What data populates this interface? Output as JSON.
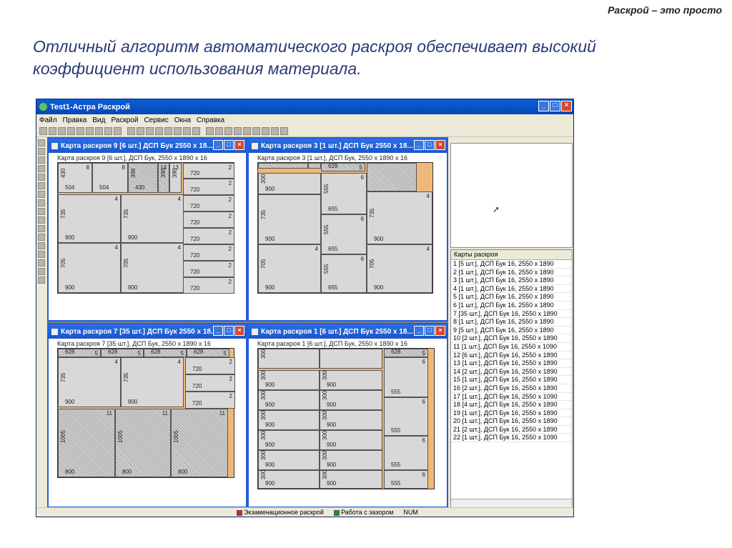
{
  "slide": {
    "header": "Раскрой – это просто",
    "title": "Отличный алгоритм автоматического раскроя обеспечивает высокий коэффициент использования материала."
  },
  "app": {
    "title": "Test1-Астра Раскрой",
    "menu": [
      "Файл",
      "Правка",
      "Вид",
      "Раскрой",
      "Сервис",
      "Окна",
      "Справка"
    ],
    "status": [
      "Экзаменационное раскрой",
      "Работа с зазором",
      "NUM"
    ]
  },
  "windows": [
    {
      "title": "Карта раскроя 9 [6 шт.] ДСП Бук 2550 x 18...",
      "caption": "Карта раскроя 9 [6 шт.], ДСП Бук, 2550 x 1890 x 16",
      "pieces": [
        {
          "w": "504",
          "h": "430",
          "c": "8",
          "hatch": false
        },
        {
          "w": "504",
          "h": "",
          "c": "8",
          "hatch": false
        },
        {
          "w": "430",
          "h": "398",
          "c": "",
          "hatch": true
        },
        {
          "w": "",
          "h": "390",
          "c": "14",
          "hatch": true
        },
        {
          "w": "",
          "h": "390",
          "c": "13",
          "hatch": false
        },
        {
          "w": "720",
          "h": "",
          "c": "2",
          "hatch": false
        },
        {
          "w": "720",
          "h": "",
          "c": "2",
          "hatch": false
        },
        {
          "w": "720",
          "h": "",
          "c": "2",
          "hatch": false
        },
        {
          "w": "720",
          "h": "",
          "c": "2",
          "hatch": false
        },
        {
          "w": "720",
          "h": "",
          "c": "2",
          "hatch": false
        },
        {
          "w": "720",
          "h": "",
          "c": "2",
          "hatch": false
        },
        {
          "w": "720",
          "h": "",
          "c": "2",
          "hatch": false
        },
        {
          "w": "720",
          "h": "",
          "c": "2",
          "hatch": false
        },
        {
          "w": "900",
          "h": "735",
          "c": "4",
          "hatch": false
        },
        {
          "w": "900",
          "h": "735",
          "c": "4",
          "hatch": false
        },
        {
          "w": "900",
          "h": "705",
          "c": "4",
          "hatch": false
        },
        {
          "w": "900",
          "h": "705",
          "c": "4",
          "hatch": false
        }
      ]
    },
    {
      "title": "Карта раскроя 3 [1 шт.] ДСП Бук 2550 x 18...",
      "caption": "Карта раскроя 3 [1 шт.], ДСП Бук, 2550 x 1890 x 16",
      "pieces": [
        {
          "w": "",
          "h": "",
          "c": "",
          "hatch": true
        },
        {
          "w": "",
          "h": "",
          "c": "",
          "hatch": true
        },
        {
          "w": "628",
          "h": "",
          "c": "5",
          "hatch": true
        },
        {
          "w": "",
          "h": "",
          "c": "",
          "hatch": true
        },
        {
          "w": "900",
          "h": "300",
          "c": "",
          "hatch": false
        },
        {
          "w": "655",
          "h": "555",
          "c": "6",
          "hatch": false
        },
        {
          "w": "900",
          "h": "735",
          "c": "",
          "hatch": false
        },
        {
          "w": "655",
          "h": "555",
          "c": "6",
          "hatch": false
        },
        {
          "w": "900",
          "h": "735",
          "c": "4",
          "hatch": false
        },
        {
          "w": "900",
          "h": "705",
          "c": "4",
          "hatch": false
        },
        {
          "w": "655",
          "h": "555",
          "c": "6",
          "hatch": false
        },
        {
          "w": "900",
          "h": "705",
          "c": "4",
          "hatch": false
        }
      ]
    },
    {
      "title": "Карта раскроя 7 [35 шт.] ДСП Бук 2550 x 18...",
      "caption": "Карта раскроя 7 [35 шт.], ДСП Бук, 2550 x 1890 x 16",
      "pieces": [
        {
          "w": "628",
          "h": "",
          "c": "5",
          "hatch": true
        },
        {
          "w": "628",
          "h": "",
          "c": "5",
          "hatch": true
        },
        {
          "w": "628",
          "h": "",
          "c": "5",
          "hatch": true
        },
        {
          "w": "628",
          "h": "",
          "c": "5",
          "hatch": true
        },
        {
          "w": "900",
          "h": "735",
          "c": "4",
          "hatch": false
        },
        {
          "w": "900",
          "h": "735",
          "c": "4",
          "hatch": false
        },
        {
          "w": "720",
          "h": "",
          "c": "2",
          "hatch": false
        },
        {
          "w": "720",
          "h": "",
          "c": "2",
          "hatch": false
        },
        {
          "w": "720",
          "h": "",
          "c": "2",
          "hatch": false
        },
        {
          "w": "800",
          "h": "1005",
          "c": "11",
          "hatch": true
        },
        {
          "w": "800",
          "h": "1005",
          "c": "11",
          "hatch": true
        },
        {
          "w": "800",
          "h": "1005",
          "c": "11",
          "hatch": true
        }
      ]
    },
    {
      "title": "Карта раскроя 1 [6 шт.] ДСП Бук 2550 x 18...",
      "caption": "Карта раскроя 1 [6 шт.], ДСП Бук, 2550 x 1890 x 16",
      "pieces": [
        {
          "w": "",
          "h": "300",
          "c": "",
          "hatch": false
        },
        {
          "w": "",
          "h": "",
          "c": "",
          "hatch": false
        },
        {
          "w": "628",
          "h": "",
          "c": "5",
          "hatch": true
        },
        {
          "w": "900",
          "h": "300",
          "c": "",
          "hatch": false
        },
        {
          "w": "900",
          "h": "300",
          "c": "",
          "hatch": false
        },
        {
          "w": "555",
          "h": "",
          "c": "6",
          "hatch": false
        },
        {
          "w": "900",
          "h": "300",
          "c": "",
          "hatch": false
        },
        {
          "w": "900",
          "h": "300",
          "c": "",
          "hatch": false
        },
        {
          "w": "900",
          "h": "300",
          "c": "",
          "hatch": false
        },
        {
          "w": "900",
          "h": "300",
          "c": "",
          "hatch": false
        },
        {
          "w": "555",
          "h": "",
          "c": "6",
          "hatch": false
        },
        {
          "w": "900",
          "h": "300",
          "c": "",
          "hatch": false
        },
        {
          "w": "900",
          "h": "300",
          "c": "",
          "hatch": false
        },
        {
          "w": "900",
          "h": "300",
          "c": "",
          "hatch": false
        },
        {
          "w": "900",
          "h": "300",
          "c": "",
          "hatch": false
        },
        {
          "w": "555",
          "h": "",
          "c": "6",
          "hatch": false
        },
        {
          "w": "900",
          "h": "300",
          "c": "",
          "hatch": false
        },
        {
          "w": "900",
          "h": "300",
          "c": "",
          "hatch": false
        },
        {
          "w": "555",
          "h": "",
          "c": "6",
          "hatch": false
        }
      ]
    }
  ],
  "list": {
    "header": "Карты раскроя",
    "items": [
      "1 [5 шт.], ДСП Бук 16, 2550 x 1890",
      "2 [1 шт.], ДСП Бук 16, 2550 x 1890",
      "3 [1 шт.], ДСП Бук 16, 2550 x 1890",
      "4 [1 шт.], ДСП Бук 16, 2550 x 1890",
      "5 [1 шт.], ДСП Бук 16, 2550 x 1890",
      "6 [1 шт.], ДСП Бук 16, 2550 x 1890",
      "7 [35 шт.], ДСП Бук 16, 2550 x 1890",
      "8 [1 шт.], ДСП Бук 16, 2550 x 1890",
      "9 [5 шт.], ДСП Бук 16, 2550 x 1890",
      "10 [2 шт.], ДСП Бук 16, 2550 x 1890",
      "11 [1 шт.], ДСП Бук 16, 2550 x 1090",
      "12 [6 шт.], ДСП Бук 16, 2550 x 1890",
      "13 [1 шт.], ДСП Бук 16, 2550 x 1890",
      "14 [2 шт.], ДСП Бук 16, 2550 x 1890",
      "15 [1 шт.], ДСП Бук 16, 2550 x 1890",
      "16 [2 шт.], ДСП Бук 16, 2550 x 1890",
      "17 [1 шт.], ДСП Бук 16, 2550 x 1090",
      "18 [4 шт.], ДСП Бук 16, 2550 x 1890",
      "19 [1 шт.], ДСП Бук 16, 2550 x 1890",
      "20 [1 шт.], ДСП Бук 16, 2550 x 1890",
      "21 [2 шт.], ДСП Бук 16, 2550 x 1890",
      "22 [1 шт.], ДСП Бук 16, 2550 x 1090"
    ]
  }
}
